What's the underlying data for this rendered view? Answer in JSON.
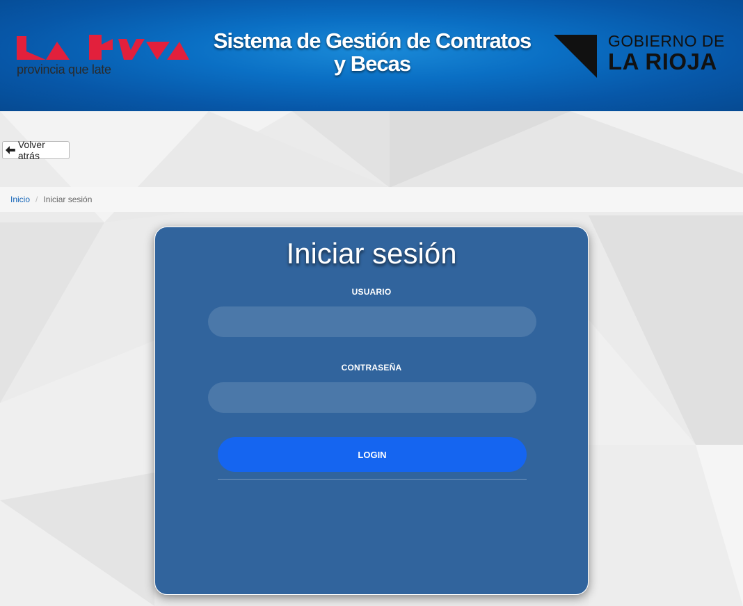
{
  "header": {
    "title_line1": "Sistema de Gestión de Contratos",
    "title_line2": "y Becas",
    "left_logo": {
      "tagline": "provincia que late",
      "wordmark": "La Rioja",
      "color": "#e2203c"
    },
    "right_logo": {
      "line1": "GOBIERNO DE",
      "line2": "LA RIOJA"
    }
  },
  "nav": {
    "back_label": "Volver atrás"
  },
  "breadcrumb": {
    "items": [
      {
        "label": "Inicio",
        "link": true
      },
      {
        "label": "Iniciar sesión",
        "link": false
      }
    ],
    "separator": "/"
  },
  "login": {
    "title": "Iniciar sesión",
    "username_label": "USUARIO",
    "username_value": "",
    "password_label": "CONTRASEÑA",
    "password_value": "",
    "submit_label": "LOGIN"
  },
  "colors": {
    "header_blue": "#0a6fc4",
    "card_blue": "#215896",
    "button_blue": "#1565f0",
    "link_blue": "#1565b8",
    "logo_red": "#e2203c"
  },
  "icons": [
    "arrow-left-icon",
    "la-rioja-logo",
    "gobierno-triangle-icon"
  ]
}
